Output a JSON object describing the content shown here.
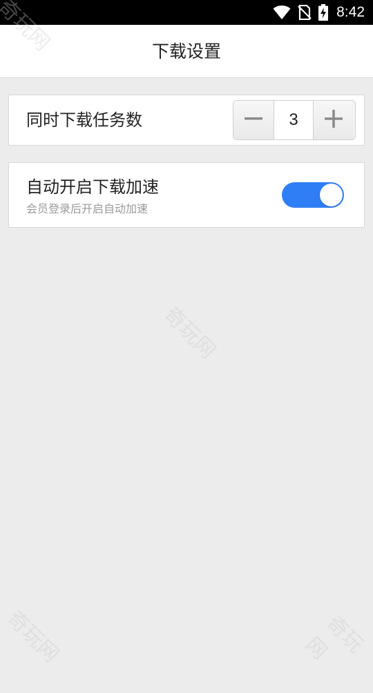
{
  "status_bar": {
    "time": "8:42",
    "icons": [
      "wifi-icon",
      "no-sim-icon",
      "battery-charging-icon"
    ]
  },
  "header": {
    "title": "下载设置"
  },
  "settings": {
    "concurrent_downloads": {
      "label": "同时下载任务数",
      "value": "3",
      "decrement_icon": "minus-icon",
      "increment_icon": "plus-icon"
    },
    "auto_acceleration": {
      "label": "自动开启下载加速",
      "sublabel": "会员登录后开启自动加速",
      "enabled": true
    }
  },
  "watermark": {
    "text": "奇玩网"
  },
  "colors": {
    "accent": "#2f7ef5",
    "background": "#ececec",
    "status_bar": "#000000"
  }
}
